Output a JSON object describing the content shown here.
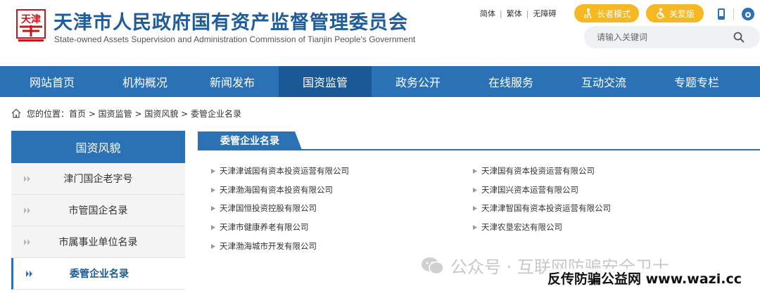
{
  "header": {
    "logo_text": "天津",
    "title_cn": "天津市人民政府国有资产监督管理委员会",
    "title_en": "State-owned Assets Supervision and Administration Commission of Tianjin People's Government",
    "toplinks": [
      "简体",
      "繁体",
      "无障碍"
    ],
    "elder_mode": "长者模式",
    "care_mode": "关爱版",
    "search_placeholder": "请输入关键词"
  },
  "nav": {
    "items": [
      {
        "label": "网站首页"
      },
      {
        "label": "机构概况"
      },
      {
        "label": "新闻发布"
      },
      {
        "label": "国资监管"
      },
      {
        "label": "政务公开"
      },
      {
        "label": "在线服务"
      },
      {
        "label": "互动交流"
      },
      {
        "label": "专题专栏"
      }
    ]
  },
  "breadcrumb": {
    "text": "您的位置：首页 > 国资监管 > 国资风貌 > 委管企业名录"
  },
  "sidebar": {
    "title": "国资风貌",
    "items": [
      {
        "label": "津门国企老字号"
      },
      {
        "label": "市管国企名录"
      },
      {
        "label": "市属事业单位名录"
      },
      {
        "label": "委管企业名录"
      }
    ]
  },
  "main": {
    "tab": "委管企业名录",
    "companies": [
      "天津津诚国有资本投资运营有限公司",
      "天津国有资本投资运营有限公司",
      "天津渤海国有资本投资有限公司",
      "天津国兴资本运营有限公司",
      "天津国恒投资控股有限公司",
      "天津津智国有资本投资运营有限公司",
      "天津市健康养老有限公司",
      "天津农垦宏达有限公司",
      "天津渤海城市开发有限公司"
    ]
  },
  "watermark": {
    "line1": "公众号 · 互联网防骗安全卫士",
    "line2": "反传防骗公益网 www.wazi.cc"
  },
  "colors": {
    "nav_bg": "#2a72b5",
    "nav_active": "#1a5896",
    "accent_yellow": "#f5b722",
    "title_blue": "#1f5c99"
  }
}
